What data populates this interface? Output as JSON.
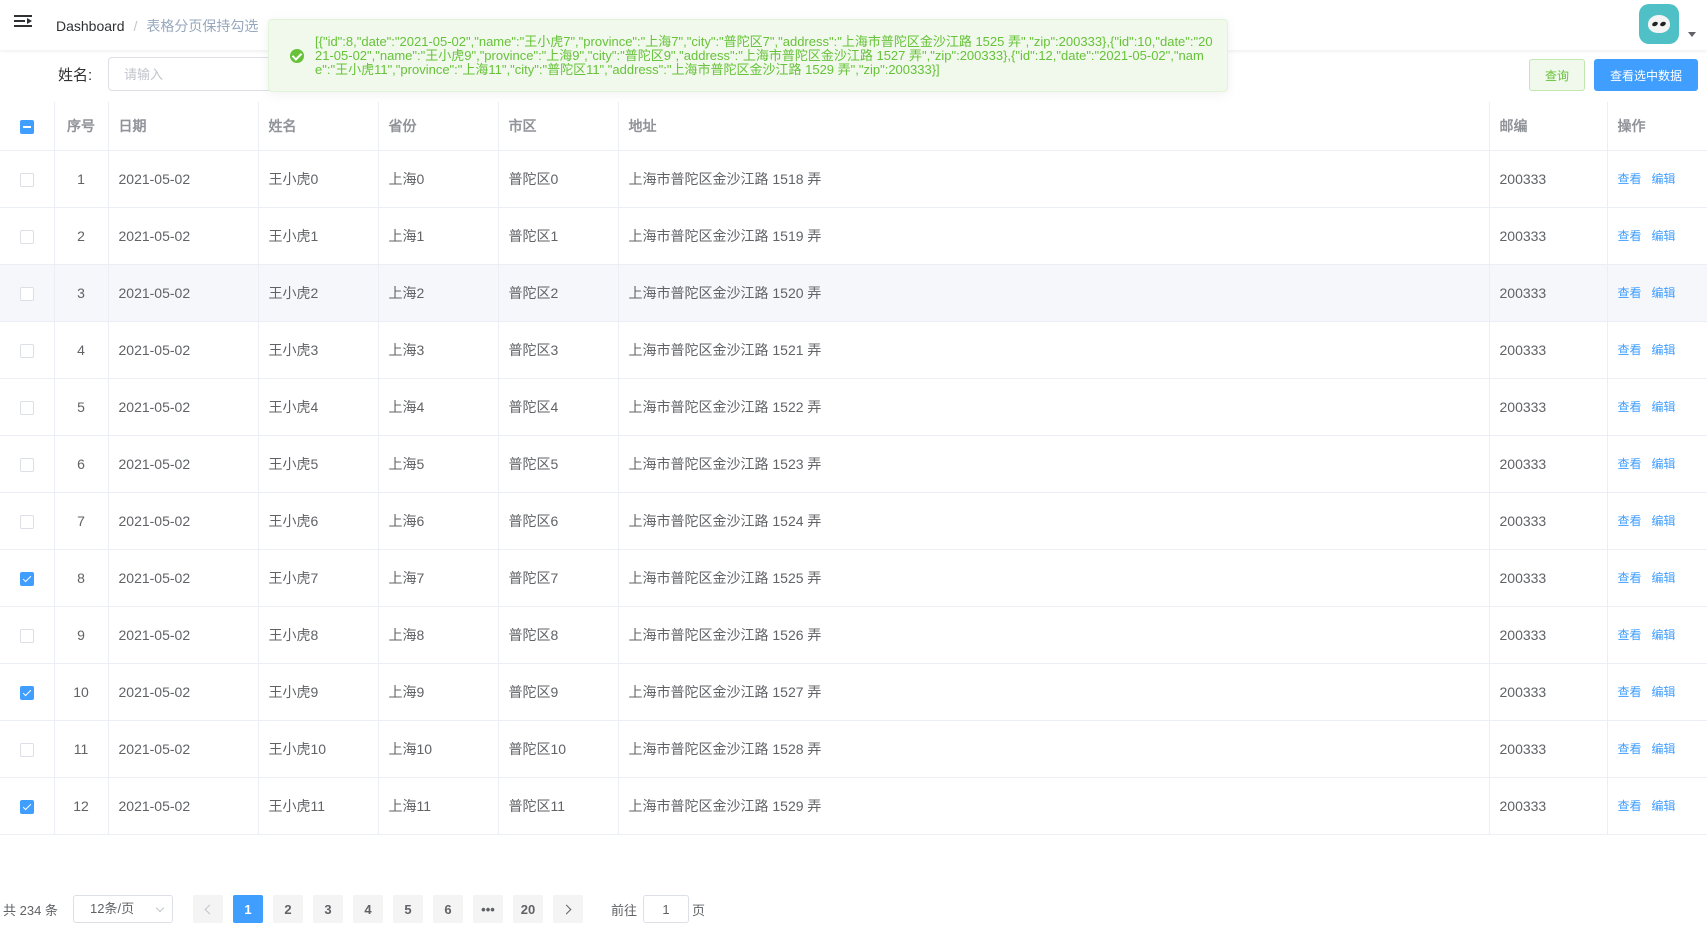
{
  "navbar": {
    "breadcrumb": [
      {
        "label": "Dashboard"
      },
      {
        "label": "表格分页保持勾选"
      }
    ]
  },
  "search": {
    "label": "姓名:",
    "placeholder": "请输入",
    "query_button": "查询",
    "view_selected_button": "查看选中数据"
  },
  "message": {
    "type": "success",
    "text": "[{\"id\":8,\"date\":\"2021-05-02\",\"name\":\"王小虎7\",\"province\":\"上海7\",\"city\":\"普陀区7\",\"address\":\"上海市普陀区金沙江路 1525 弄\",\"zip\":200333},{\"id\":10,\"date\":\"2021-05-02\",\"name\":\"王小虎9\",\"province\":\"上海9\",\"city\":\"普陀区9\",\"address\":\"上海市普陀区金沙江路 1527 弄\",\"zip\":200333},{\"id\":12,\"date\":\"2021-05-02\",\"name\":\"王小虎11\",\"province\":\"上海11\",\"city\":\"普陀区11\",\"address\":\"上海市普陀区金沙江路 1529 弄\",\"zip\":200333}]"
  },
  "table": {
    "header_checkbox": "indeterminate",
    "columns": [
      "序号",
      "日期",
      "姓名",
      "省份",
      "市区",
      "地址",
      "邮编",
      "操作"
    ],
    "actions": [
      "查看",
      "编辑"
    ],
    "rows": [
      {
        "checked": false,
        "index": "1",
        "date": "2021-05-02",
        "name": "王小虎0",
        "province": "上海0",
        "city": "普陀区0",
        "address": "上海市普陀区金沙江路 1518 弄",
        "zip": "200333"
      },
      {
        "checked": false,
        "index": "2",
        "date": "2021-05-02",
        "name": "王小虎1",
        "province": "上海1",
        "city": "普陀区1",
        "address": "上海市普陀区金沙江路 1519 弄",
        "zip": "200333"
      },
      {
        "checked": false,
        "index": "3",
        "date": "2021-05-02",
        "name": "王小虎2",
        "province": "上海2",
        "city": "普陀区2",
        "address": "上海市普陀区金沙江路 1520 弄",
        "zip": "200333",
        "hover": true
      },
      {
        "checked": false,
        "index": "4",
        "date": "2021-05-02",
        "name": "王小虎3",
        "province": "上海3",
        "city": "普陀区3",
        "address": "上海市普陀区金沙江路 1521 弄",
        "zip": "200333"
      },
      {
        "checked": false,
        "index": "5",
        "date": "2021-05-02",
        "name": "王小虎4",
        "province": "上海4",
        "city": "普陀区4",
        "address": "上海市普陀区金沙江路 1522 弄",
        "zip": "200333"
      },
      {
        "checked": false,
        "index": "6",
        "date": "2021-05-02",
        "name": "王小虎5",
        "province": "上海5",
        "city": "普陀区5",
        "address": "上海市普陀区金沙江路 1523 弄",
        "zip": "200333"
      },
      {
        "checked": false,
        "index": "7",
        "date": "2021-05-02",
        "name": "王小虎6",
        "province": "上海6",
        "city": "普陀区6",
        "address": "上海市普陀区金沙江路 1524 弄",
        "zip": "200333"
      },
      {
        "checked": true,
        "index": "8",
        "date": "2021-05-02",
        "name": "王小虎7",
        "province": "上海7",
        "city": "普陀区7",
        "address": "上海市普陀区金沙江路 1525 弄",
        "zip": "200333"
      },
      {
        "checked": false,
        "index": "9",
        "date": "2021-05-02",
        "name": "王小虎8",
        "province": "上海8",
        "city": "普陀区8",
        "address": "上海市普陀区金沙江路 1526 弄",
        "zip": "200333"
      },
      {
        "checked": true,
        "index": "10",
        "date": "2021-05-02",
        "name": "王小虎9",
        "province": "上海9",
        "city": "普陀区9",
        "address": "上海市普陀区金沙江路 1527 弄",
        "zip": "200333"
      },
      {
        "checked": false,
        "index": "11",
        "date": "2021-05-02",
        "name": "王小虎10",
        "province": "上海10",
        "city": "普陀区10",
        "address": "上海市普陀区金沙江路 1528 弄",
        "zip": "200333"
      },
      {
        "checked": true,
        "index": "12",
        "date": "2021-05-02",
        "name": "王小虎11",
        "province": "上海11",
        "city": "普陀区11",
        "address": "上海市普陀区金沙江路 1529 弄",
        "zip": "200333"
      }
    ]
  },
  "pagination": {
    "total_text": "共 234 条",
    "page_size": "12条/页",
    "pages": [
      "1",
      "2",
      "3",
      "4",
      "5",
      "6",
      "•••",
      "20"
    ],
    "current_page": "1",
    "goto_label": "前往",
    "goto_value": "1",
    "goto_suffix": "页"
  },
  "colors": {
    "primary": "#409eff",
    "success": "#67c23a",
    "success_bg": "#f0f9eb"
  }
}
